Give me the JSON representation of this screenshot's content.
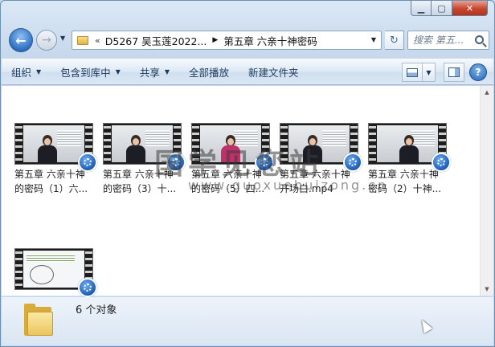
{
  "window": {
    "controls": {
      "minimize": "▁",
      "maximize": "▢",
      "close": "✕"
    }
  },
  "nav": {
    "back_icon": "←",
    "forward_icon": "→",
    "breadcrumb_prefix": "«",
    "breadcrumb": [
      "D5267 吴玉莲2022...",
      "第五章 六亲十神密码"
    ],
    "refresh_icon": "↻",
    "search_placeholder": "搜索 第五..."
  },
  "toolbar": {
    "items": [
      {
        "label": "组织",
        "dropdown": true
      },
      {
        "label": "包含到库中",
        "dropdown": true
      },
      {
        "label": "共享",
        "dropdown": true
      },
      {
        "label": "全部播放",
        "dropdown": false
      },
      {
        "label": "新建文件夹",
        "dropdown": false
      }
    ],
    "help_icon": "?"
  },
  "files": [
    {
      "name": "第五章 六亲十神的密码（1）六...",
      "line1": "第五章 六亲十神",
      "line2": "的密码（1）六...",
      "thumb": "video-teacher"
    },
    {
      "name": "第五章 六亲十神的密码（3）十...",
      "line1": "第五章 六亲十神",
      "line2": "的密码（3）十...",
      "thumb": "video-teacher"
    },
    {
      "name": "第五章 六亲十神的密码（5）四...",
      "line1": "第五章 六亲十神",
      "line2": "的密码（5）四...",
      "thumb": "video-teacher"
    },
    {
      "name": "第五章 六亲十神开场白.mp4",
      "line1": "第五章 六亲十神",
      "line2": "开场白.mp4",
      "thumb": "video-teacher"
    },
    {
      "name": "第五章 六亲十神密码（2）十神...",
      "line1": "第五章 六亲十神",
      "line2": "密码（2）十神...",
      "thumb": "video-teacher"
    },
    {
      "name": "",
      "line1": "",
      "line2": "",
      "thumb": "video-slide"
    }
  ],
  "watermark": {
    "cn": "国学见您站",
    "en": "www.guoxuebuizong.cn"
  },
  "details": {
    "count": "6 个对象"
  },
  "colors": {
    "accent": "#2d6fc0",
    "close": "#c7452d",
    "folder": "#eac55d"
  }
}
